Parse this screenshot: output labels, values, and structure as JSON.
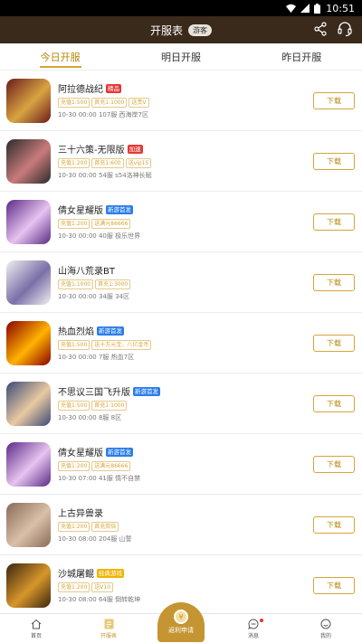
{
  "status_bar": {
    "time": "10:51"
  },
  "header": {
    "title": "开服表",
    "guest_badge": "游客"
  },
  "tabs": [
    {
      "label": "今日开服"
    },
    {
      "label": "明日开服"
    },
    {
      "label": "昨日开服"
    }
  ],
  "games": [
    {
      "name": "阿拉德战纪",
      "badge": "精品",
      "badge_color": "#e53935",
      "tags": [
        "充值1:500",
        "首充1:1000",
        "送贵V"
      ],
      "meta": "10-30 00:00 107服 西海岸7区",
      "icon_colors": [
        "#6a1b1b",
        "#d9a441"
      ]
    },
    {
      "name": "三十六策-无限版",
      "badge": "加速",
      "badge_color": "#e53935",
      "tags": [
        "充值1:200",
        "首充1:600",
        "送vip15"
      ],
      "meta": "10-30 00:00 54服 s54洛神长赋",
      "icon_colors": [
        "#2b2b2b",
        "#c97b7b"
      ]
    },
    {
      "name": "倩女星耀版",
      "badge": "新游首发",
      "badge_color": "#2b7de9",
      "tags": [
        "充值1:200",
        "送满元86666"
      ],
      "meta": "10-30 00:00 40服 极乐世界",
      "icon_colors": [
        "#5b2a86",
        "#e6c3f0"
      ]
    },
    {
      "name": "山海八荒录BT",
      "badge": "",
      "badge_color": "",
      "tags": [
        "充值1:1000",
        "首充1:3000"
      ],
      "meta": "10-30 00:00 34服 34区",
      "icon_colors": [
        "#f0f0f0",
        "#7b6fa8"
      ]
    },
    {
      "name": "热血烈焰",
      "badge": "新游首发",
      "badge_color": "#2b7de9",
      "tags": [
        "充值1:500",
        "送十万元宝，八亿金币"
      ],
      "meta": "10-30 00:00 7服 热血7区",
      "icon_colors": [
        "#8b0000",
        "#ffb300"
      ]
    },
    {
      "name": "不思议三国飞升版",
      "badge": "新游首发",
      "badge_color": "#2b7de9",
      "tags": [
        "充值1:500",
        "首充1:1000"
      ],
      "meta": "10-30 00:00 8服 8区",
      "icon_colors": [
        "#3a4a7a",
        "#e9c9a0"
      ]
    },
    {
      "name": "倩女星耀版",
      "badge": "新游首发",
      "badge_color": "#2b7de9",
      "tags": [
        "充值1:200",
        "送满元86666"
      ],
      "meta": "10-30 07:00 41服 情不自禁",
      "icon_colors": [
        "#5b2a86",
        "#e6c3f0"
      ]
    },
    {
      "name": "上古异兽录",
      "badge": "",
      "badge_color": "",
      "tags": [
        "充值1:200",
        "首充双倍"
      ],
      "meta": "10-30 08:00 204服 山誓",
      "icon_colors": [
        "#8a6a5a",
        "#d9c0a8"
      ]
    },
    {
      "name": "沙城屠鲲",
      "badge": "经典游戏",
      "badge_color": "#f0b400",
      "tags": [
        "充值1:200",
        "送V10"
      ],
      "meta": "10-30 08:00 64服 倒转乾坤",
      "icon_colors": [
        "#3a2510",
        "#d7962a"
      ]
    }
  ],
  "download_label": "下载",
  "bottom_nav": [
    {
      "label": "首页",
      "icon": "home-icon"
    },
    {
      "label": "开服表",
      "icon": "server-list-icon"
    },
    {
      "label": "返利申请",
      "icon": "coin-icon"
    },
    {
      "label": "消息",
      "icon": "message-icon"
    },
    {
      "label": "我的",
      "icon": "profile-icon"
    }
  ],
  "colors": {
    "header_bg": "#3a2a1b",
    "accent": "#c59532"
  }
}
